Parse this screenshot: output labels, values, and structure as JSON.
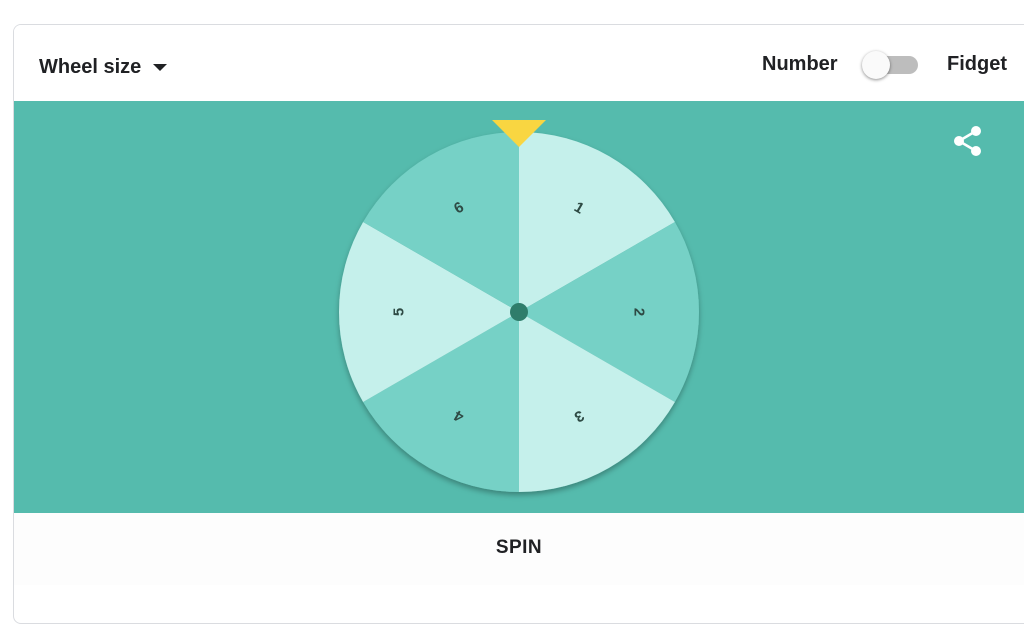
{
  "toolbar": {
    "size_label": "Wheel size",
    "mode_left": "Number",
    "mode_right": "Fidget",
    "toggle_on": false
  },
  "wheel": {
    "segments": [
      "1",
      "2",
      "3",
      "4",
      "5",
      "6"
    ],
    "colors": {
      "stage": "#55bbad",
      "light": "#c5f0eb",
      "dark": "#76d1c6",
      "pointer": "#f9d641",
      "hub": "#2f7d6b",
      "text": "#2e4a44"
    },
    "icons": {
      "pointer": "triangle-pointer-icon",
      "share": "share-icon"
    }
  },
  "footer": {
    "spin_label": "SPIN"
  }
}
